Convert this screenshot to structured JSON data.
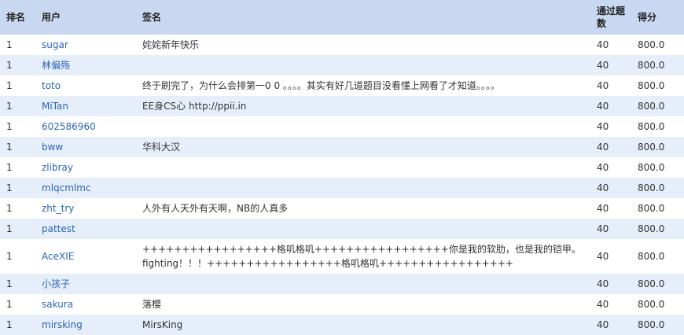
{
  "headers": {
    "rank": "排名",
    "user": "用户",
    "signature": "签名",
    "solved": "通过题数",
    "score": "得分"
  },
  "rows": [
    {
      "rank": "1",
      "user": "sugar",
      "signature": "姹姹新年快乐",
      "solved": "40",
      "score": "800.0"
    },
    {
      "rank": "1",
      "user": "林偏殇",
      "signature": "",
      "solved": "40",
      "score": "800.0"
    },
    {
      "rank": "1",
      "user": "toto",
      "signature": "终于刷完了，为什么会排第一0 0 。。。。其实有好几道题目没看懂上网看了才知道。。。。",
      "solved": "40",
      "score": "800.0"
    },
    {
      "rank": "1",
      "user": "MiTan",
      "signature": "EE身CS心 http://ppii.in",
      "solved": "40",
      "score": "800.0"
    },
    {
      "rank": "1",
      "user": "602586960",
      "signature": "",
      "solved": "40",
      "score": "800.0"
    },
    {
      "rank": "1",
      "user": "bww",
      "signature": "华科大汉",
      "solved": "40",
      "score": "800.0"
    },
    {
      "rank": "1",
      "user": "zlibray",
      "signature": "",
      "solved": "40",
      "score": "800.0"
    },
    {
      "rank": "1",
      "user": "mlqcmlmc",
      "signature": "",
      "solved": "40",
      "score": "800.0"
    },
    {
      "rank": "1",
      "user": "zht_try",
      "signature": "人外有人天外有天啊，NB的人真多",
      "solved": "40",
      "score": "800.0"
    },
    {
      "rank": "1",
      "user": "pattest",
      "signature": "",
      "solved": "40",
      "score": "800.0"
    },
    {
      "rank": "1",
      "user": "AceXIE",
      "signature": "+++++++++++++++++格叽格叽+++++++++++++++++你是我的软肋，也是我的铠甲。fighting！！！+++++++++++++++++格叽格叽+++++++++++++++++",
      "solved": "40",
      "score": "800.0"
    },
    {
      "rank": "1",
      "user": "小孩子",
      "signature": "",
      "solved": "40",
      "score": "800.0"
    },
    {
      "rank": "1",
      "user": "sakura",
      "signature": "落樱",
      "solved": "40",
      "score": "800.0"
    },
    {
      "rank": "1",
      "user": "mirsking",
      "signature": "MirsKing",
      "solved": "40",
      "score": "800.0"
    }
  ]
}
